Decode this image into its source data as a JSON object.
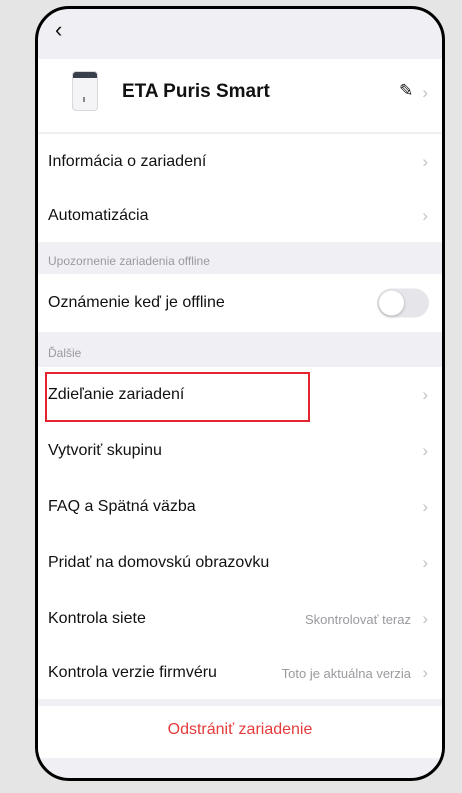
{
  "header": {
    "back_icon": "chevron-left-icon"
  },
  "device": {
    "name": "ETA Puris Smart",
    "image_icon": "air-purifier-icon",
    "edit_icon": "pencil-icon"
  },
  "rows_top": [
    {
      "label": "Informácia o zariadení"
    },
    {
      "label": "Automatizácia"
    }
  ],
  "offline_section": {
    "title": "Upozornenie zariadenia offline",
    "toggle_label": "Oznámenie keď je offline",
    "toggle_on": false
  },
  "more_section": {
    "title": "Ďalšie",
    "items": [
      {
        "label": "Zdieľanie zariadení"
      },
      {
        "label": "Vytvoriť skupinu"
      },
      {
        "label": "FAQ a Spätná väzba"
      },
      {
        "label": "Pridať na domovskú obrazovku"
      },
      {
        "label": "Kontrola siete",
        "value": "Skontrolovať teraz"
      },
      {
        "label": "Kontrola verzie firmvéru",
        "value": "Toto je aktuálna verzia"
      }
    ]
  },
  "remove_button": "Odstrániť zariadenie",
  "colors": {
    "highlight": "#e4242f",
    "danger": "#e53b3b",
    "background": "#efeff4"
  }
}
